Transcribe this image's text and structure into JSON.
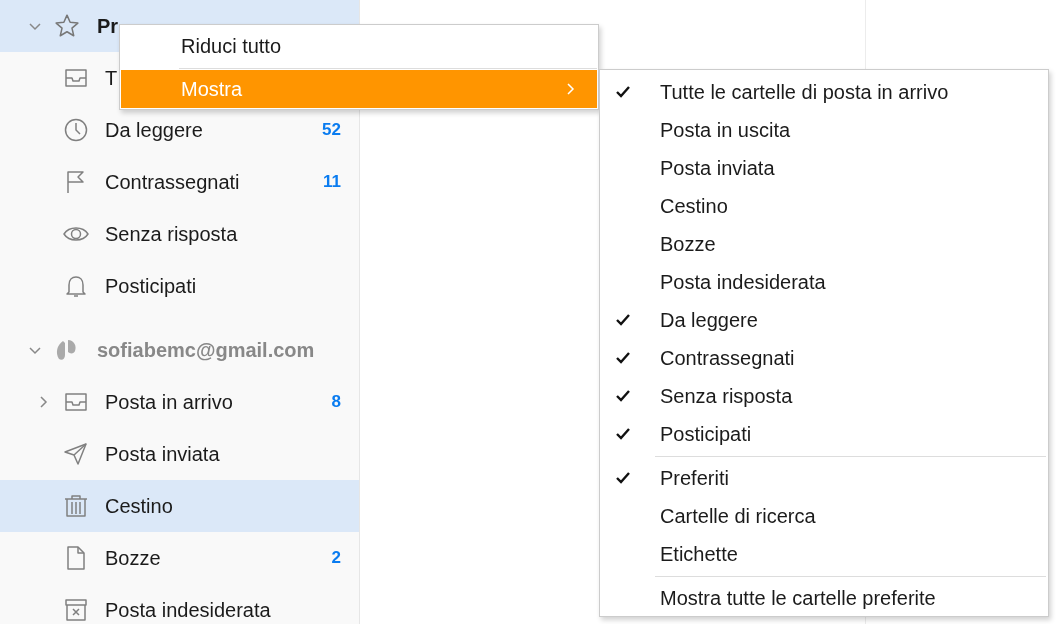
{
  "sidebar": {
    "groups": [
      {
        "kind": "favorites",
        "label": "Pr",
        "expanded": true,
        "selected": true,
        "items": [
          {
            "kind": "inbox",
            "label": "T",
            "selected": false
          },
          {
            "kind": "clock",
            "label": "Da leggere",
            "count": "52",
            "selected": false
          },
          {
            "kind": "flag",
            "label": "Contrassegnati",
            "count": "11",
            "selected": false
          },
          {
            "kind": "eye",
            "label": "Senza risposta",
            "selected": false
          },
          {
            "kind": "bell",
            "label": "Posticipati",
            "selected": false
          }
        ]
      },
      {
        "kind": "account",
        "label": "sofiabemc@gmail.com",
        "expanded": true,
        "selected": false,
        "items": [
          {
            "kind": "inbox",
            "label": "Posta in arrivo",
            "count": "8",
            "selected": false,
            "expanded": false
          },
          {
            "kind": "sent",
            "label": "Posta inviata",
            "selected": false
          },
          {
            "kind": "trash",
            "label": "Cestino",
            "selected": true
          },
          {
            "kind": "draft",
            "label": "Bozze",
            "count": "2",
            "selected": false
          },
          {
            "kind": "junk",
            "label": "Posta indesiderata",
            "selected": false
          }
        ]
      }
    ]
  },
  "context_menu": {
    "items": [
      {
        "label": "Riduci tutto",
        "selected": false,
        "submenu": false
      },
      {
        "label": "Mostra",
        "selected": true,
        "submenu": true
      }
    ]
  },
  "submenu": {
    "sections": [
      {
        "items": [
          {
            "label": "Tutte le cartelle di posta in arrivo",
            "checked": true
          },
          {
            "label": "Posta in uscita",
            "checked": false
          },
          {
            "label": "Posta inviata",
            "checked": false
          },
          {
            "label": "Cestino",
            "checked": false
          },
          {
            "label": "Bozze",
            "checked": false
          },
          {
            "label": "Posta indesiderata",
            "checked": false
          },
          {
            "label": "Da leggere",
            "checked": true
          },
          {
            "label": "Contrassegnati",
            "checked": true
          },
          {
            "label": "Senza risposta",
            "checked": true
          },
          {
            "label": "Posticipati",
            "checked": true
          }
        ]
      },
      {
        "items": [
          {
            "label": "Preferiti",
            "checked": true
          },
          {
            "label": "Cartelle di ricerca",
            "checked": false
          },
          {
            "label": "Etichette",
            "checked": false
          }
        ]
      },
      {
        "items": [
          {
            "label": "Mostra tutte le cartelle preferite",
            "checked": false
          }
        ]
      }
    ]
  }
}
